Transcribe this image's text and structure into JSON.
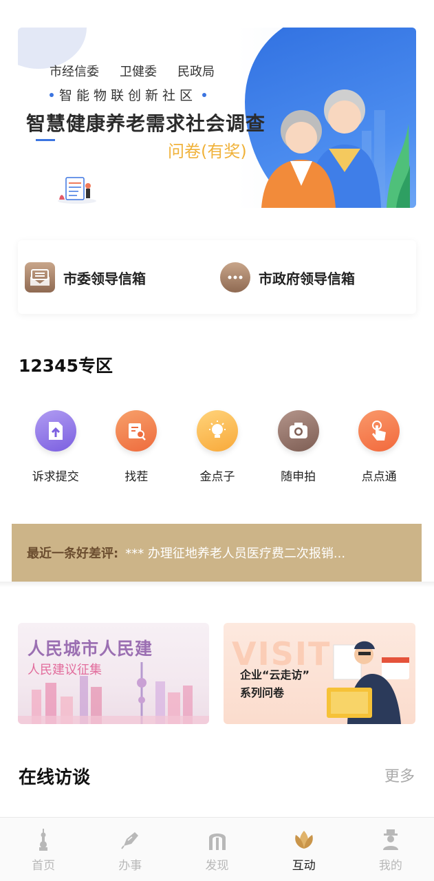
{
  "banner": {
    "orgs": [
      "市经信委",
      "卫健委",
      "民政局"
    ],
    "subtitle": "智能物联创新社区",
    "title": "智慧健康养老需求社会调查",
    "title_tag": "问卷(有奖)"
  },
  "mailbox": {
    "left_label": "市委领导信箱",
    "right_label": "市政府领导信箱"
  },
  "section_12345": {
    "title": "12345专区",
    "items": [
      {
        "label": "诉求提交",
        "icon": "upload-document-icon"
      },
      {
        "label": "找茬",
        "icon": "search-document-icon"
      },
      {
        "label": "金点子",
        "icon": "lightbulb-icon"
      },
      {
        "label": "随申拍",
        "icon": "camera-icon"
      },
      {
        "label": "点点通",
        "icon": "tap-finger-icon"
      }
    ]
  },
  "review": {
    "label": "最近一条好差评:",
    "text": "*** 办理征地养老人员医疗费二次报销..."
  },
  "promos": {
    "left_title": "人民城市人民建",
    "left_sub": "人民建议征集",
    "right_bg": "VISIT",
    "right_line1": "企业“云走访”",
    "right_line2": "系列问卷"
  },
  "interview": {
    "title": "在线访谈",
    "more": "更多"
  },
  "tabbar": {
    "items": [
      {
        "label": "首页",
        "icon": "tower-icon"
      },
      {
        "label": "办事",
        "icon": "pen-icon"
      },
      {
        "label": "发现",
        "icon": "arch-icon"
      },
      {
        "label": "互动",
        "icon": "magnolia-icon"
      },
      {
        "label": "我的",
        "icon": "person-icon"
      }
    ],
    "active_index": 3
  }
}
